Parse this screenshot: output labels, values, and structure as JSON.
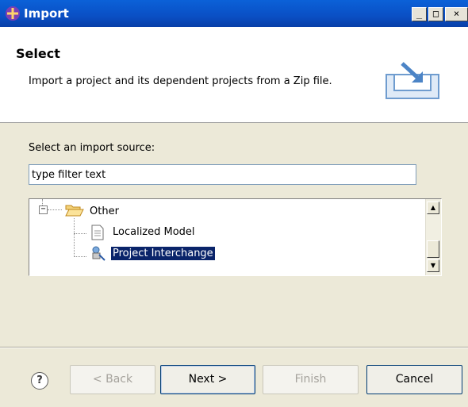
{
  "window": {
    "title": "Import",
    "minimize_glyph": "_",
    "maximize_glyph": "□",
    "close_glyph": "×"
  },
  "header": {
    "title": "Select",
    "description": "Import a project and its dependent projects from a Zip file."
  },
  "source": {
    "label": "Select an import source:",
    "filter_value": "type filter text"
  },
  "tree": {
    "items": [
      {
        "label": "Other",
        "icon": "folder-open-icon",
        "expander": "−"
      },
      {
        "label": "Localized Model",
        "icon": "document-icon"
      },
      {
        "label": "Project Interchange",
        "icon": "project-interchange-icon",
        "selected": true
      }
    ]
  },
  "buttons": {
    "help": "?",
    "back": "< Back",
    "next": "Next >",
    "finish": "Finish",
    "cancel": "Cancel"
  },
  "colors": {
    "titlebar": "#0a4fc4",
    "selection": "#0a246a",
    "dialog_bg": "#ece9d8"
  }
}
